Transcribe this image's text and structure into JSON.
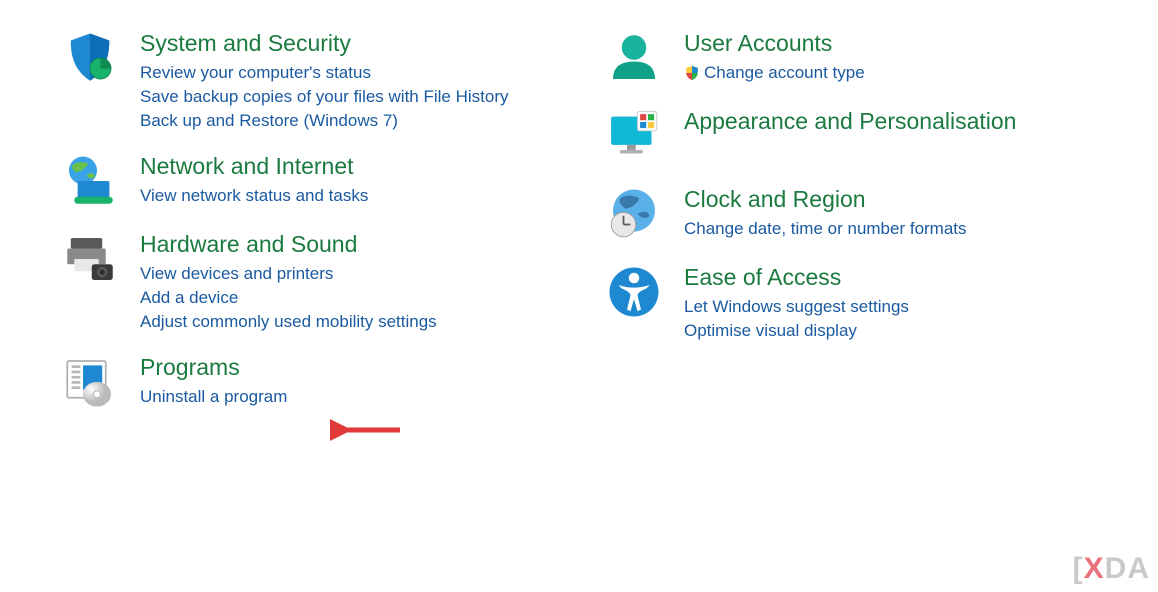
{
  "left": {
    "system": {
      "title": "System and Security",
      "links": [
        "Review your computer's status",
        "Save backup copies of your files with File History",
        "Back up and Restore (Windows 7)"
      ]
    },
    "network": {
      "title": "Network and Internet",
      "links": [
        "View network status and tasks"
      ]
    },
    "hardware": {
      "title": "Hardware and Sound",
      "links": [
        "View devices and printers",
        "Add a device",
        "Adjust commonly used mobility settings"
      ]
    },
    "programs": {
      "title": "Programs",
      "links": [
        "Uninstall a program"
      ]
    }
  },
  "right": {
    "users": {
      "title": "User Accounts",
      "links": [
        "Change account type"
      ]
    },
    "appearance": {
      "title": "Appearance and Personalisation",
      "links": []
    },
    "clock": {
      "title": "Clock and Region",
      "links": [
        "Change date, time or number formats"
      ]
    },
    "ease": {
      "title": "Ease of Access",
      "links": [
        "Let Windows suggest settings",
        "Optimise visual display"
      ]
    }
  },
  "watermark": {
    "prefix": "[",
    "x": "X",
    "rest": "DA"
  }
}
